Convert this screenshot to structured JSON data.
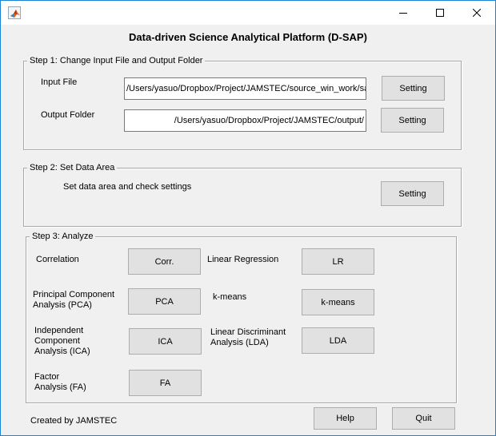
{
  "window": {
    "title": "",
    "controls": {
      "minimize": "minimize",
      "maximize": "maximize",
      "close": "close"
    },
    "accent": "#1883d7"
  },
  "main_title": "Data-driven Science Analytical Platform (D-SAP)",
  "step1": {
    "title": "Step 1: Change Input File and Output Folder",
    "input_file_label": "Input File",
    "input_file_value": "/Users/yasuo/Dropbox/Project/JAMSTEC/source_win_work/sa",
    "input_setting_label": "Setting",
    "output_folder_label": "Output Folder",
    "output_folder_value": "/Users/yasuo/Dropbox/Project/JAMSTEC/output/",
    "output_setting_label": "Setting"
  },
  "step2": {
    "title": "Step 2: Set Data Area",
    "description": "Set data area and check settings",
    "setting_label": "Setting"
  },
  "step3": {
    "title": "Step 3: Analyze",
    "correlation_label": "Correlation",
    "corr_button": "Corr.",
    "lr_label": "Linear Regression",
    "lr_button": "LR",
    "pca_label_line1": "Principal Component",
    "pca_label_line2": "Analysis (PCA)",
    "pca_button": "PCA",
    "kmeans_label": "k-means",
    "kmeans_button": "k-means",
    "ica_label_line1": "Independent",
    "ica_label_line2": "Component",
    "ica_label_line3": "Analysis (ICA)",
    "ica_button": "ICA",
    "lda_label_line1": "Linear Discriminant",
    "lda_label_line2": "Analysis (LDA)",
    "lda_button": "LDA",
    "fa_label_line1": "Factor",
    "fa_label_line2": "Analysis (FA)",
    "fa_button": "FA"
  },
  "footer": {
    "created_by": "Created by JAMSTEC",
    "help_button": "Help",
    "quit_button": "Quit"
  },
  "icons": {
    "app": "matlab-logo-icon",
    "minimize": "minimize-icon",
    "maximize": "maximize-icon",
    "close": "close-icon"
  }
}
